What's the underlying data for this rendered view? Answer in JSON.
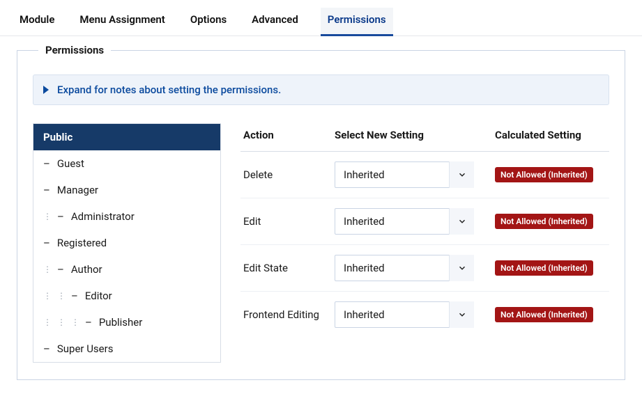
{
  "tabs": [
    {
      "label": "Module",
      "active": false
    },
    {
      "label": "Menu Assignment",
      "active": false
    },
    {
      "label": "Options",
      "active": false
    },
    {
      "label": "Advanced",
      "active": false
    },
    {
      "label": "Permissions",
      "active": true
    }
  ],
  "fieldset_title": "Permissions",
  "expand_notice": "Expand for notes about setting the permissions.",
  "groups": [
    {
      "label": "Public",
      "depth": 0,
      "active": true
    },
    {
      "label": "Guest",
      "depth": 1,
      "active": false
    },
    {
      "label": "Manager",
      "depth": 1,
      "active": false
    },
    {
      "label": "Administrator",
      "depth": 2,
      "active": false
    },
    {
      "label": "Registered",
      "depth": 1,
      "active": false
    },
    {
      "label": "Author",
      "depth": 2,
      "active": false
    },
    {
      "label": "Editor",
      "depth": 3,
      "active": false
    },
    {
      "label": "Publisher",
      "depth": 4,
      "active": false
    },
    {
      "label": "Super Users",
      "depth": 1,
      "active": false
    }
  ],
  "table": {
    "headers": {
      "action": "Action",
      "setting": "Select New Setting",
      "calculated": "Calculated Setting"
    },
    "rows": [
      {
        "action": "Delete",
        "setting": "Inherited",
        "calculated": "Not Allowed (Inherited)"
      },
      {
        "action": "Edit",
        "setting": "Inherited",
        "calculated": "Not Allowed (Inherited)"
      },
      {
        "action": "Edit State",
        "setting": "Inherited",
        "calculated": "Not Allowed (Inherited)"
      },
      {
        "action": "Frontend Editing",
        "setting": "Inherited",
        "calculated": "Not Allowed (Inherited)"
      }
    ]
  }
}
